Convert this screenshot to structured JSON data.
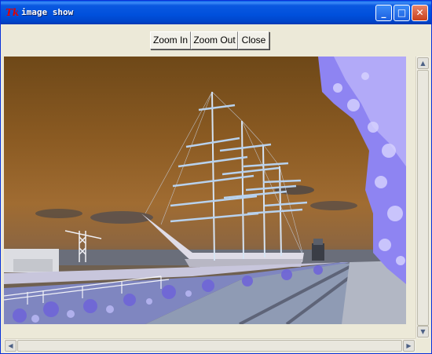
{
  "window": {
    "title": "image show",
    "app_icon_glyph": "Tk",
    "controls": {
      "minimize": "_",
      "maximize": "□",
      "close": "✕"
    }
  },
  "toolbar": {
    "buttons": [
      {
        "label": "Zoom In"
      },
      {
        "label": "Zoom Out"
      },
      {
        "label": "Close"
      }
    ]
  },
  "image": {
    "subject": "tall ship in harbor (color-inverted photo)",
    "colors": {
      "sky": "#8a5a22",
      "foliage": "#8f83f5",
      "ground": "#b5bbcf",
      "hull": "#e0dde8"
    }
  },
  "scrollbars": {
    "vertical": {
      "up_glyph": "▲",
      "down_glyph": "▼"
    },
    "horizontal": {
      "left_glyph": "◀",
      "right_glyph": "▶"
    }
  }
}
